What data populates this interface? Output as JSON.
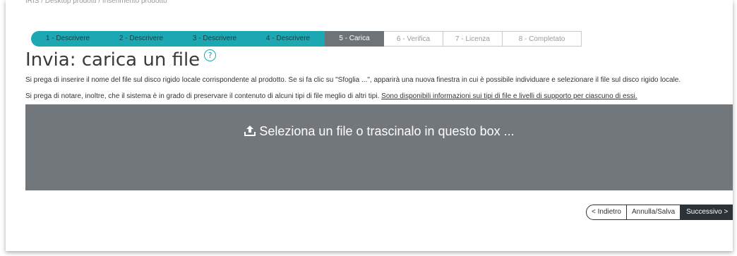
{
  "breadcrumb": "IRIS / Desktop prodotti / Inserimento prodotto",
  "steps": [
    {
      "label": "1 - Descrivere",
      "state": "done"
    },
    {
      "label": "2 - Descrivere",
      "state": "done"
    },
    {
      "label": "3 - Descrivere",
      "state": "done"
    },
    {
      "label": "4 - Descrivere",
      "state": "done"
    },
    {
      "label": "5 - Carica",
      "state": "current"
    },
    {
      "label": "6 - Verifica",
      "state": "todo"
    },
    {
      "label": "7 - Licenza",
      "state": "todo"
    },
    {
      "label": "8 - Completato",
      "state": "todo"
    }
  ],
  "page": {
    "title": "Invia: carica un file",
    "help_icon": "question-circle-icon",
    "info1": "Si prega di inserire il nome del file sul disco rigido locale corrispondente al prodotto. Se si fa clic su \"Sfoglia ...\", apparirà una nuova finestra in cui è possibile individuare e selezionare il file sul disco rigido locale.",
    "info2_prefix": "Si prega di notare, inoltre, che il sistema è in grado di preservare il contenuto di alcuni tipi di file meglio di altri tipi.",
    "info2_link": "Sono disponibili informazioni sui tipi di file e livelli di supporto per ciascuno di essi."
  },
  "dropzone": {
    "icon": "upload-icon",
    "label": "Seleziona un file o trascinalo in questo box ..."
  },
  "nav": {
    "back": "< Indietro",
    "cancel": "Annulla/Salva",
    "next": "Successivo >"
  },
  "colors": {
    "step_done": "#1ba8b2",
    "step_current": "#6e7378",
    "dropzone": "#72777b",
    "next_button": "#2b3238"
  }
}
